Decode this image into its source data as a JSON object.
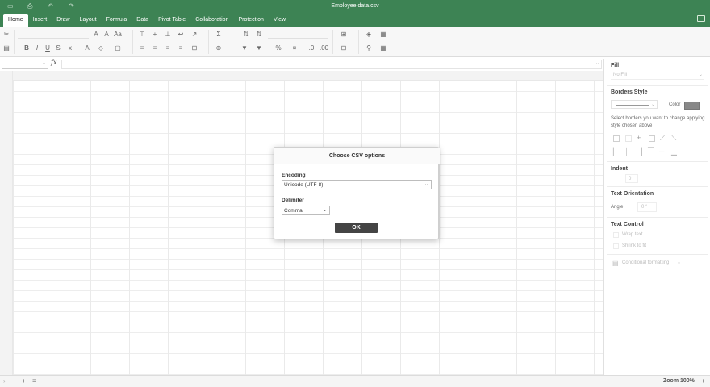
{
  "window": {
    "title": "Employee data.csv"
  },
  "tabs": [
    "Home",
    "Insert",
    "Draw",
    "Layout",
    "Formula",
    "Data",
    "Pivot Table",
    "Collaboration",
    "Protection",
    "View"
  ],
  "formula_bar": {
    "fx": "fx",
    "name_box": "",
    "value": ""
  },
  "right_panel": {
    "fill_title": "Fill",
    "fill_value": "No Fill",
    "borders_title": "Borders Style",
    "color_label": "Color",
    "borders_hint": "Select borders you want to change applying style chosen above",
    "indent_title": "Indent",
    "indent_value": "0",
    "orientation_title": "Text Orientation",
    "angle_label": "Angle",
    "angle_value": "0 °",
    "text_control_title": "Text Control",
    "wrap_text": "Wrap text",
    "shrink_to_fit": "Shrink to fit",
    "conditional_formatting": "Conditional formatting",
    "swatch_color": "#888888"
  },
  "dialog": {
    "title": "Choose CSV options",
    "encoding_label": "Encoding",
    "encoding_value": "Unicode (UTF-8)",
    "delimiter_label": "Delimiter",
    "delimiter_value": "Comma",
    "ok_label": "OK"
  },
  "statusbar": {
    "zoom": "Zoom 100%",
    "minus": "−",
    "plus": "+",
    "add_sheet": "+"
  },
  "colors": {
    "accent": "#3d8354",
    "ok_button": "#444444"
  }
}
